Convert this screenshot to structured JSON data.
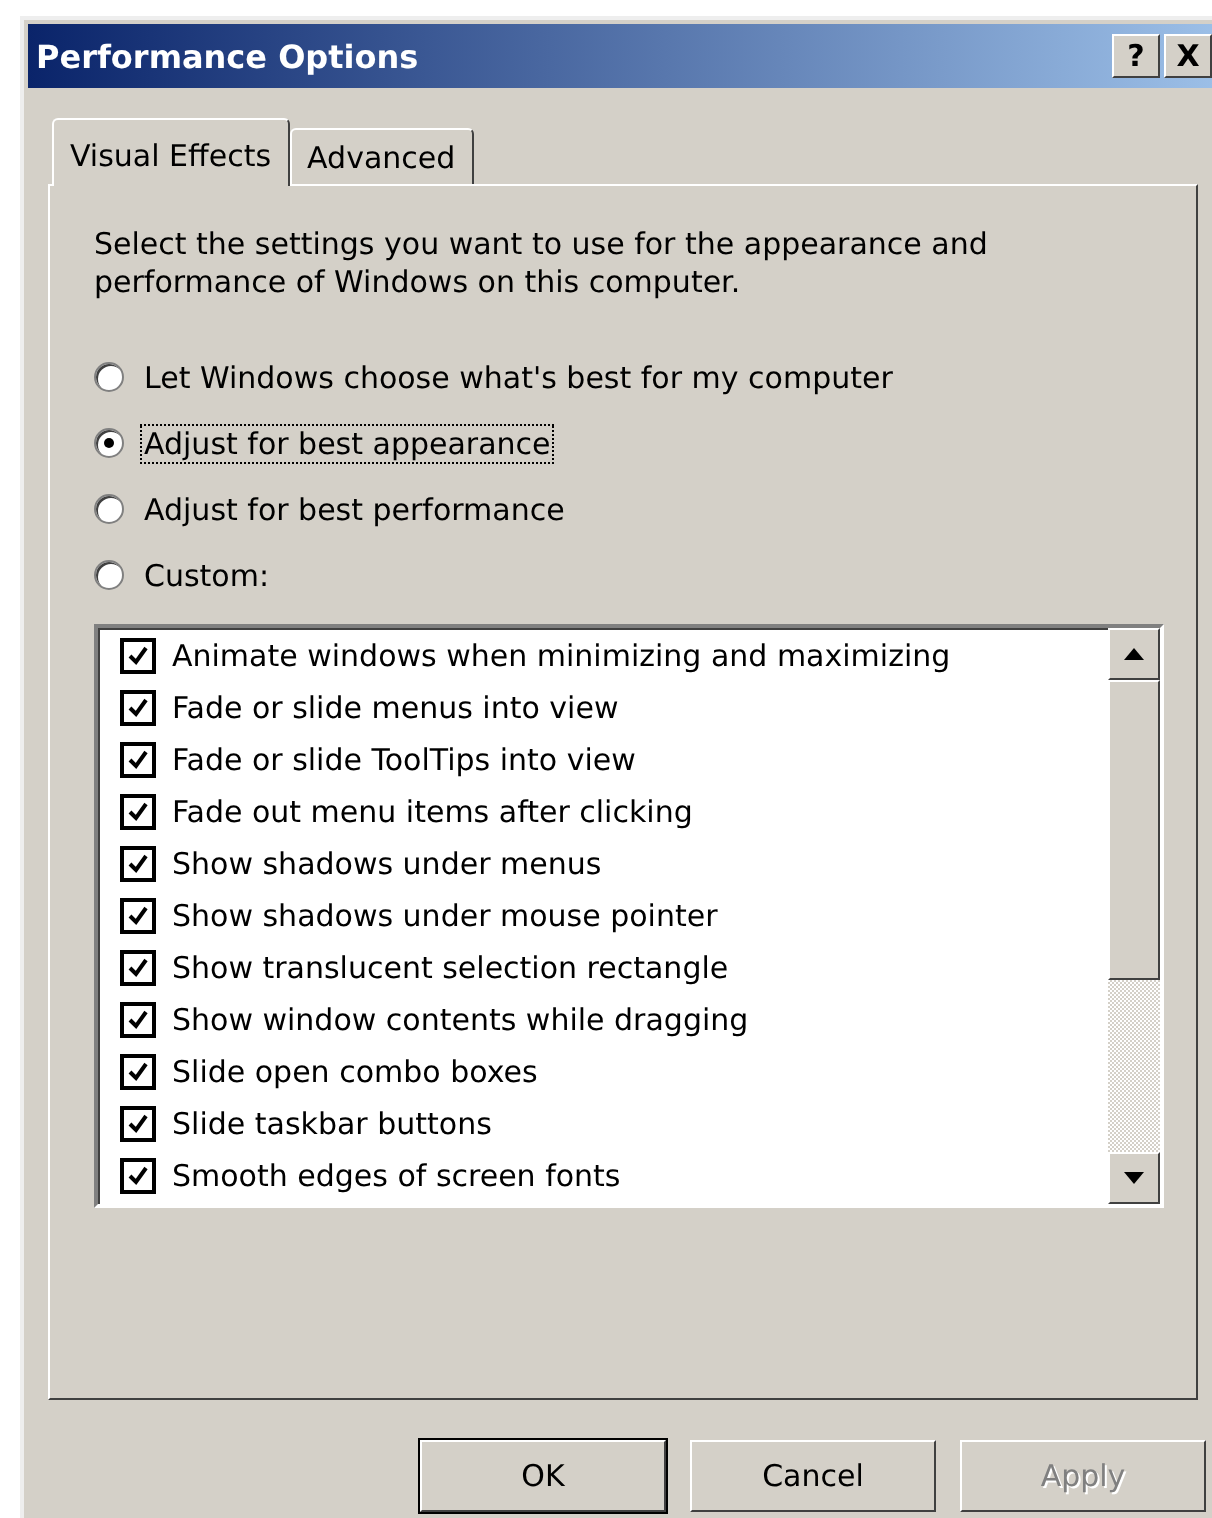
{
  "window": {
    "title": "Performance Options",
    "title_buttons": [
      "?",
      "X"
    ]
  },
  "tabs": [
    {
      "label": "Visual Effects",
      "selected": true
    },
    {
      "label": "Advanced",
      "selected": false
    }
  ],
  "description": "Select the settings you want to use for the appearance and performance of Windows on this computer.",
  "options": [
    {
      "label": "Let Windows choose what's best for my computer",
      "selected": false,
      "focused": false
    },
    {
      "label": "Adjust for best appearance",
      "selected": true,
      "focused": true
    },
    {
      "label": "Adjust for best performance",
      "selected": false,
      "focused": false
    },
    {
      "label": "Custom:",
      "selected": false,
      "focused": false
    }
  ],
  "effects": [
    {
      "label": "Animate windows when minimizing and maximizing",
      "checked": true
    },
    {
      "label": "Fade or slide menus into view",
      "checked": true
    },
    {
      "label": "Fade or slide ToolTips into view",
      "checked": true
    },
    {
      "label": "Fade out menu items after clicking",
      "checked": true
    },
    {
      "label": "Show shadows under menus",
      "checked": true
    },
    {
      "label": "Show shadows under mouse pointer",
      "checked": true
    },
    {
      "label": "Show translucent selection rectangle",
      "checked": true
    },
    {
      "label": "Show window contents while dragging",
      "checked": true
    },
    {
      "label": "Slide open combo boxes",
      "checked": true
    },
    {
      "label": "Slide taskbar buttons",
      "checked": true
    },
    {
      "label": "Smooth edges of screen fonts",
      "checked": true
    }
  ],
  "buttons": [
    {
      "label": "OK",
      "default": true,
      "disabled": false
    },
    {
      "label": "Cancel",
      "default": false,
      "disabled": false
    },
    {
      "label": "Apply",
      "default": false,
      "disabled": true
    }
  ]
}
